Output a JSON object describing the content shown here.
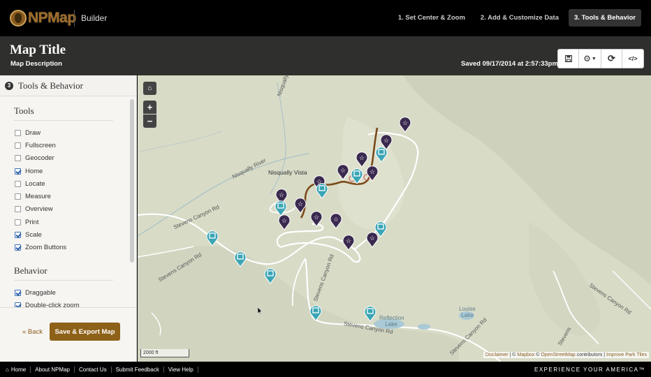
{
  "nav": {
    "logo_text": "NPMap",
    "app_name": "Builder",
    "steps": [
      {
        "label": "1. Set Center & Zoom"
      },
      {
        "label": "2. Add & Customize Data"
      },
      {
        "label": "3. Tools & Behavior"
      }
    ],
    "active_step": 2
  },
  "header": {
    "title": "Map Title",
    "description": "Map Description",
    "saved": "Saved 09/17/2014 at 2:57:33pm",
    "buttons": [
      "save-icon",
      "gear-icon",
      "refresh-icon",
      "code-icon"
    ]
  },
  "sidebar": {
    "step_number": "3",
    "heading": "Tools & Behavior",
    "tools_heading": "Tools",
    "tools": [
      {
        "label": "Draw",
        "checked": false
      },
      {
        "label": "Fullscreen",
        "checked": false
      },
      {
        "label": "Geocoder",
        "checked": false
      },
      {
        "label": "Home",
        "checked": true
      },
      {
        "label": "Locate",
        "checked": false
      },
      {
        "label": "Measure",
        "checked": false
      },
      {
        "label": "Overview",
        "checked": false
      },
      {
        "label": "Print",
        "checked": false
      },
      {
        "label": "Scale",
        "checked": true
      },
      {
        "label": "Zoom Buttons",
        "checked": true
      }
    ],
    "behavior_heading": "Behavior",
    "behavior": [
      {
        "label": "Draggable",
        "checked": true
      },
      {
        "label": "Double-click zoom",
        "checked": true
      }
    ],
    "back_label": "« Back",
    "export_label": "Save & Export Map"
  },
  "map": {
    "labels": {
      "nisqually_river_1": "Nisqually River",
      "nisqually_river_2": "Nisqually River",
      "nisqually_vista": "Nisqually Vista",
      "stevens_canyon_1": "Stevens Canyon Rd",
      "stevens_canyon_2": "Stevens Canyon Rd",
      "stevens_canyon_3": "Stevens Canyon Rd",
      "stevens_canyon_4": "Stevens Canyon Rd",
      "stevens_canyon_5": "Stevens Canyon Rd",
      "stevens_canyon_6": "Stevens Canyon Rd",
      "reflection_lake": "Reflection Lake",
      "louise_lake": "Louise Lake",
      "stevens_7": "Stevens"
    },
    "scale_label": "2000 ft",
    "attribution": {
      "disclaimer": "Disclaimer",
      "sep1": " | © ",
      "mapbox": "Mapbox",
      "sep2": " © ",
      "osm": "OpenStreetMap",
      "contrib": " contributors | ",
      "improve": "Improve Park Tiles"
    },
    "colors": {
      "terrain": "#d9dcc7",
      "trail": "#7a4a1a",
      "star_pin": "#3b2a4f",
      "square_pin": "#3aa5b5"
    }
  },
  "footer": {
    "links": [
      "Home",
      "About NPMap",
      "Contact Us",
      "Submit Feedback",
      "View Help"
    ],
    "tagline": "EXPERIENCE YOUR AMERICA™"
  }
}
